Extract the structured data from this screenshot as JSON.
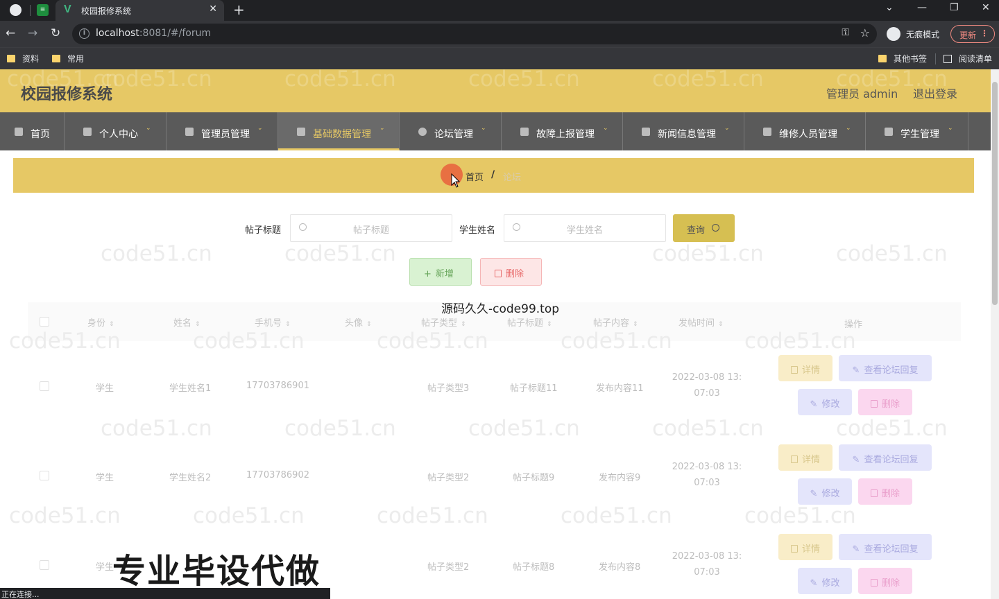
{
  "browser": {
    "tab_title": "校园报修系统",
    "url_host": "localhost",
    "url_rest": ":8081/#/forum",
    "incognito_label": "无痕模式",
    "update_label": "更新",
    "bookmarks": [
      "资料",
      "常用"
    ],
    "bookmarks_right": [
      "其他书签",
      "阅读清单"
    ],
    "status": "正在连接..."
  },
  "header": {
    "title": "校园报修系统",
    "admin": "管理员 admin",
    "logout": "退出登录",
    "color": "#e6c865"
  },
  "menu": [
    {
      "label": "首页",
      "icon": "home-icon"
    },
    {
      "label": "个人中心",
      "icon": "user-icon"
    },
    {
      "label": "管理员管理",
      "icon": "user-icon"
    },
    {
      "label": "基础数据管理",
      "icon": "list-icon",
      "active": true
    },
    {
      "label": "论坛管理",
      "icon": "forum-icon"
    },
    {
      "label": "故障上报管理",
      "icon": "user-icon"
    },
    {
      "label": "新闻信息管理",
      "icon": "send-icon"
    },
    {
      "label": "维修人员管理",
      "icon": "send-icon"
    },
    {
      "label": "学生管理",
      "icon": "cup-icon"
    }
  ],
  "breadcrumb": {
    "home": "首页",
    "separator": "/",
    "current": "论坛"
  },
  "search": {
    "title_label": "帖子标题",
    "title_placeholder": "帖子标题",
    "name_label": "学生姓名",
    "name_placeholder": "学生姓名",
    "query_button": "查询"
  },
  "actions": {
    "add": "新增",
    "delete": "删除"
  },
  "overlay_text": "源码久久-code99.top",
  "table": {
    "columns": [
      "身份",
      "姓名",
      "手机号",
      "头像",
      "帖子类型",
      "帖子标题",
      "帖子内容",
      "发帖时间",
      "操作"
    ],
    "rows": [
      {
        "role": "学生",
        "name": "学生姓名1",
        "phone": "17703786901",
        "type": "帖子类型3",
        "title": "帖子标题11",
        "content": "发布内容11",
        "date_line1": "2022-03-08 13:",
        "date_line2": "07:03"
      },
      {
        "role": "学生",
        "name": "学生姓名2",
        "phone": "17703786902",
        "type": "帖子类型2",
        "title": "帖子标题9",
        "content": "发布内容9",
        "date_line1": "2022-03-08 13:",
        "date_line2": "07:03"
      },
      {
        "role": "学生",
        "name": "",
        "phone": "",
        "type": "帖子类型2",
        "title": "帖子标题8",
        "content": "发布内容8",
        "date_line1": "2022-03-08 13:",
        "date_line2": "07:03"
      }
    ],
    "ops": {
      "detail": "详情",
      "reply": "查看论坛回复",
      "edit": "修改",
      "delete": "删除"
    }
  },
  "watermark": "code51.cn",
  "promo": "专业毕设代做"
}
